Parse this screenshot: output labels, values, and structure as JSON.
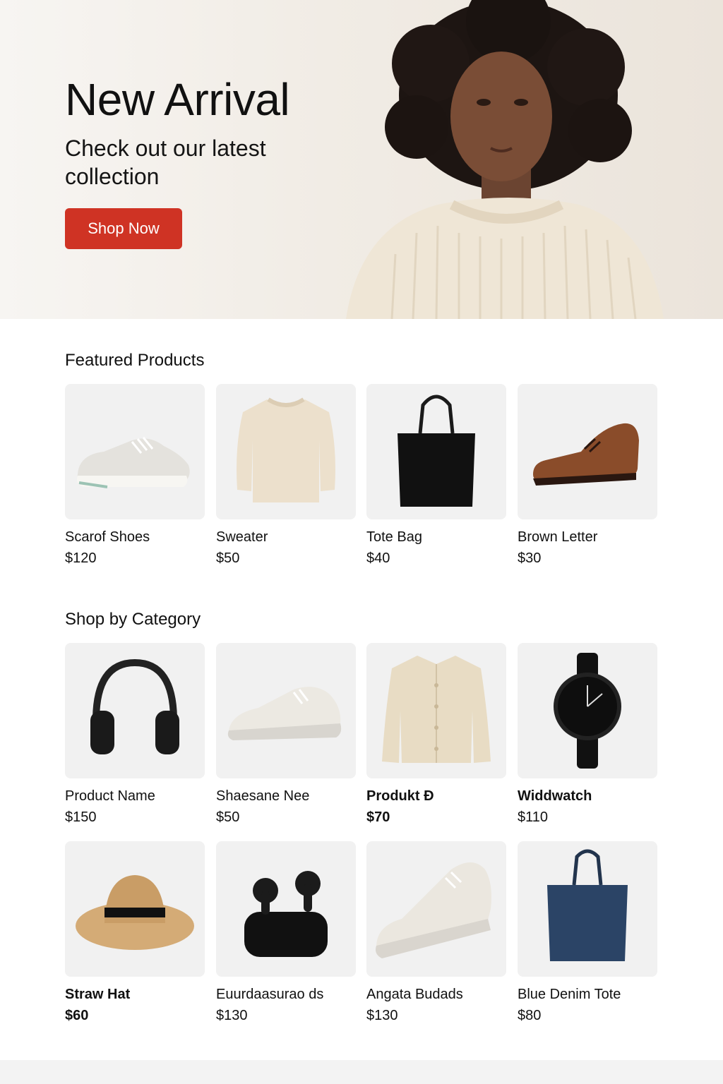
{
  "hero": {
    "title": "New Arrival",
    "subtitle": "Check out our latest collection",
    "cta_label": "Shop Now",
    "cta_color": "#cf3324"
  },
  "featured": {
    "title": "Featured Products",
    "items": [
      {
        "name": "Scarof Shoes",
        "price": "$120",
        "icon": "sneaker-icon"
      },
      {
        "name": "Sweater",
        "price": "$50",
        "icon": "sweater-icon"
      },
      {
        "name": "Tote Bag",
        "price": "$40",
        "icon": "tote-bag-icon"
      },
      {
        "name": "Brown Letter",
        "price": "$30",
        "icon": "leather-shoe-icon"
      }
    ]
  },
  "category": {
    "title": "Shop by Category",
    "items": [
      {
        "name": "Product Name",
        "price": "$150",
        "icon": "headphones-icon"
      },
      {
        "name": "Shaesane Nee",
        "price": "$50",
        "icon": "sneaker-icon"
      },
      {
        "name": "Produkt Đ",
        "price": "$70",
        "icon": "shirt-jacket-icon"
      },
      {
        "name": "Widdwatch",
        "price": "$110",
        "icon": "watch-icon"
      },
      {
        "name": "Straw Hat",
        "price": "$60",
        "icon": "straw-hat-icon"
      },
      {
        "name": "Euurdaasurao ds",
        "price": "$130",
        "icon": "earbuds-icon"
      },
      {
        "name": "Angata Budads",
        "price": "$130",
        "icon": "sneaker-icon"
      },
      {
        "name": "Blue Denim Tote",
        "price": "$80",
        "icon": "tote-bag-icon"
      }
    ]
  }
}
